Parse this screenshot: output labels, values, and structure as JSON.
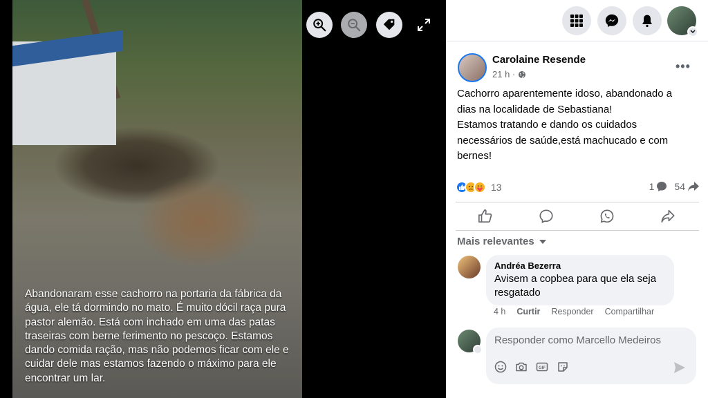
{
  "viewer": {
    "caption": "Abandonaram esse cachorro na portaria da fábrica da água, ele tá dormindo no mato. É muito dócil raça pura pastor alemão. Está com inchado em uma das patas traseiras com berne ferimento no pescoço. Estamos dando comida ração, mas não podemos ficar com ele e cuidar dele mas estamos fazendo o máximo para ele encontrar um lar."
  },
  "post": {
    "author": "Carolaine Resende",
    "time": "21 h ·",
    "text_lines": [
      "Cachorro aparentemente idoso, abandonado a",
      "dias na localidade de Sebastiana!",
      "Estamos tratando e dando os cuidados",
      "necessários de saúde,está machucado e com",
      "bernes!"
    ],
    "reaction_count": "13",
    "comment_count": "1",
    "share_count": "54"
  },
  "comments": {
    "sort_label": "Mais relevantes",
    "items": [
      {
        "name": "Andréa Bezerra",
        "text": "Avisem a copbea para que ela seja resgatado",
        "time": "4 h",
        "like": "Curtir",
        "reply": "Responder",
        "share": "Compartilhar"
      }
    ],
    "reply_placeholder": "Responder como Marcello Medeiros"
  },
  "colors": {
    "accent": "#1877f2",
    "muted": "#65676b",
    "bubble": "#f0f2f5"
  }
}
